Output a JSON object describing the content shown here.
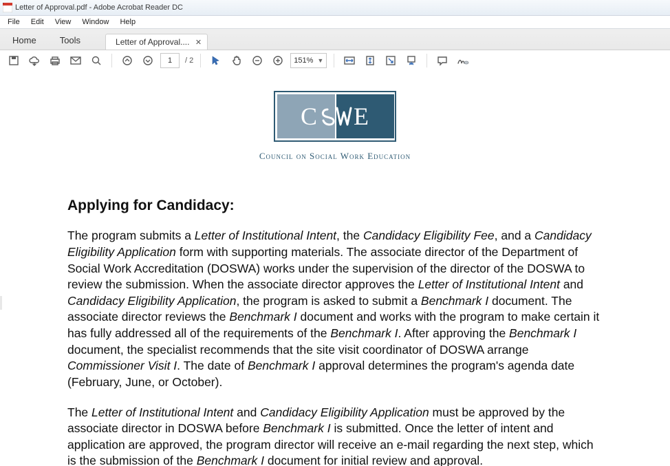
{
  "window": {
    "title": "Letter of Approval.pdf - Adobe Acrobat Reader DC"
  },
  "menu": {
    "file": "File",
    "edit": "Edit",
    "view": "View",
    "window": "Window",
    "help": "Help"
  },
  "tabs": {
    "home": "Home",
    "tools": "Tools",
    "doc": "Letter of Approval...."
  },
  "toolbar": {
    "page_current": "1",
    "page_total": "/ 2",
    "zoom": "151%"
  },
  "logo": {
    "letters": "CSWE",
    "org": "Council on Social Work Education"
  },
  "doc": {
    "heading": "Applying for Candidacy:",
    "para1_parts": {
      "t0": "The program submits a ",
      "i0": "Letter of Institutional Intent",
      "t1": ", the ",
      "i1": "Candidacy Eligibility Fee",
      "t2": ", and a ",
      "i2": "Candidacy Eligibility Application",
      "t3": " form with supporting materials.  The associate director of the Department of Social Work Accreditation (DOSWA) works under the supervision of the director of the DOSWA to review the submission.  When the associate director approves the ",
      "i3": "Letter of Institutional Intent",
      "t4": " and ",
      "i4": "Candidacy Eligibility Application",
      "t5": ", the program is asked to submit a ",
      "i5": "Benchmark I",
      "t6": " document.  The associate director reviews the ",
      "i6": "Benchmark I",
      "t7": " document and works with the program to make certain it has fully addressed all of the requirements of the ",
      "i7": "Benchmark I",
      "t8": ".  After approving the ",
      "i8": "Benchmark I",
      "t9": " document, the specialist recommends that the site visit coordinator of DOSWA arrange ",
      "i9": "Commissioner Visit I",
      "t10": ".  The date of ",
      "i10": "Benchmark I",
      "t11": " approval determines the program's agenda date (February, June, or October)."
    },
    "para2_parts": {
      "t0": "The ",
      "i0": "Letter of Institutional Intent",
      "t1": " and ",
      "i1": "Candidacy Eligibility Application",
      "t2": " must be approved by the associate director in DOSWA before ",
      "i2": "Benchmark I",
      "t3": " is submitted.  Once the letter of intent and application are approved, the program director will receive an e-mail regarding the next step, which is the submission of the ",
      "i3": "Benchmark I",
      "t4": " document for initial review and approval."
    }
  }
}
